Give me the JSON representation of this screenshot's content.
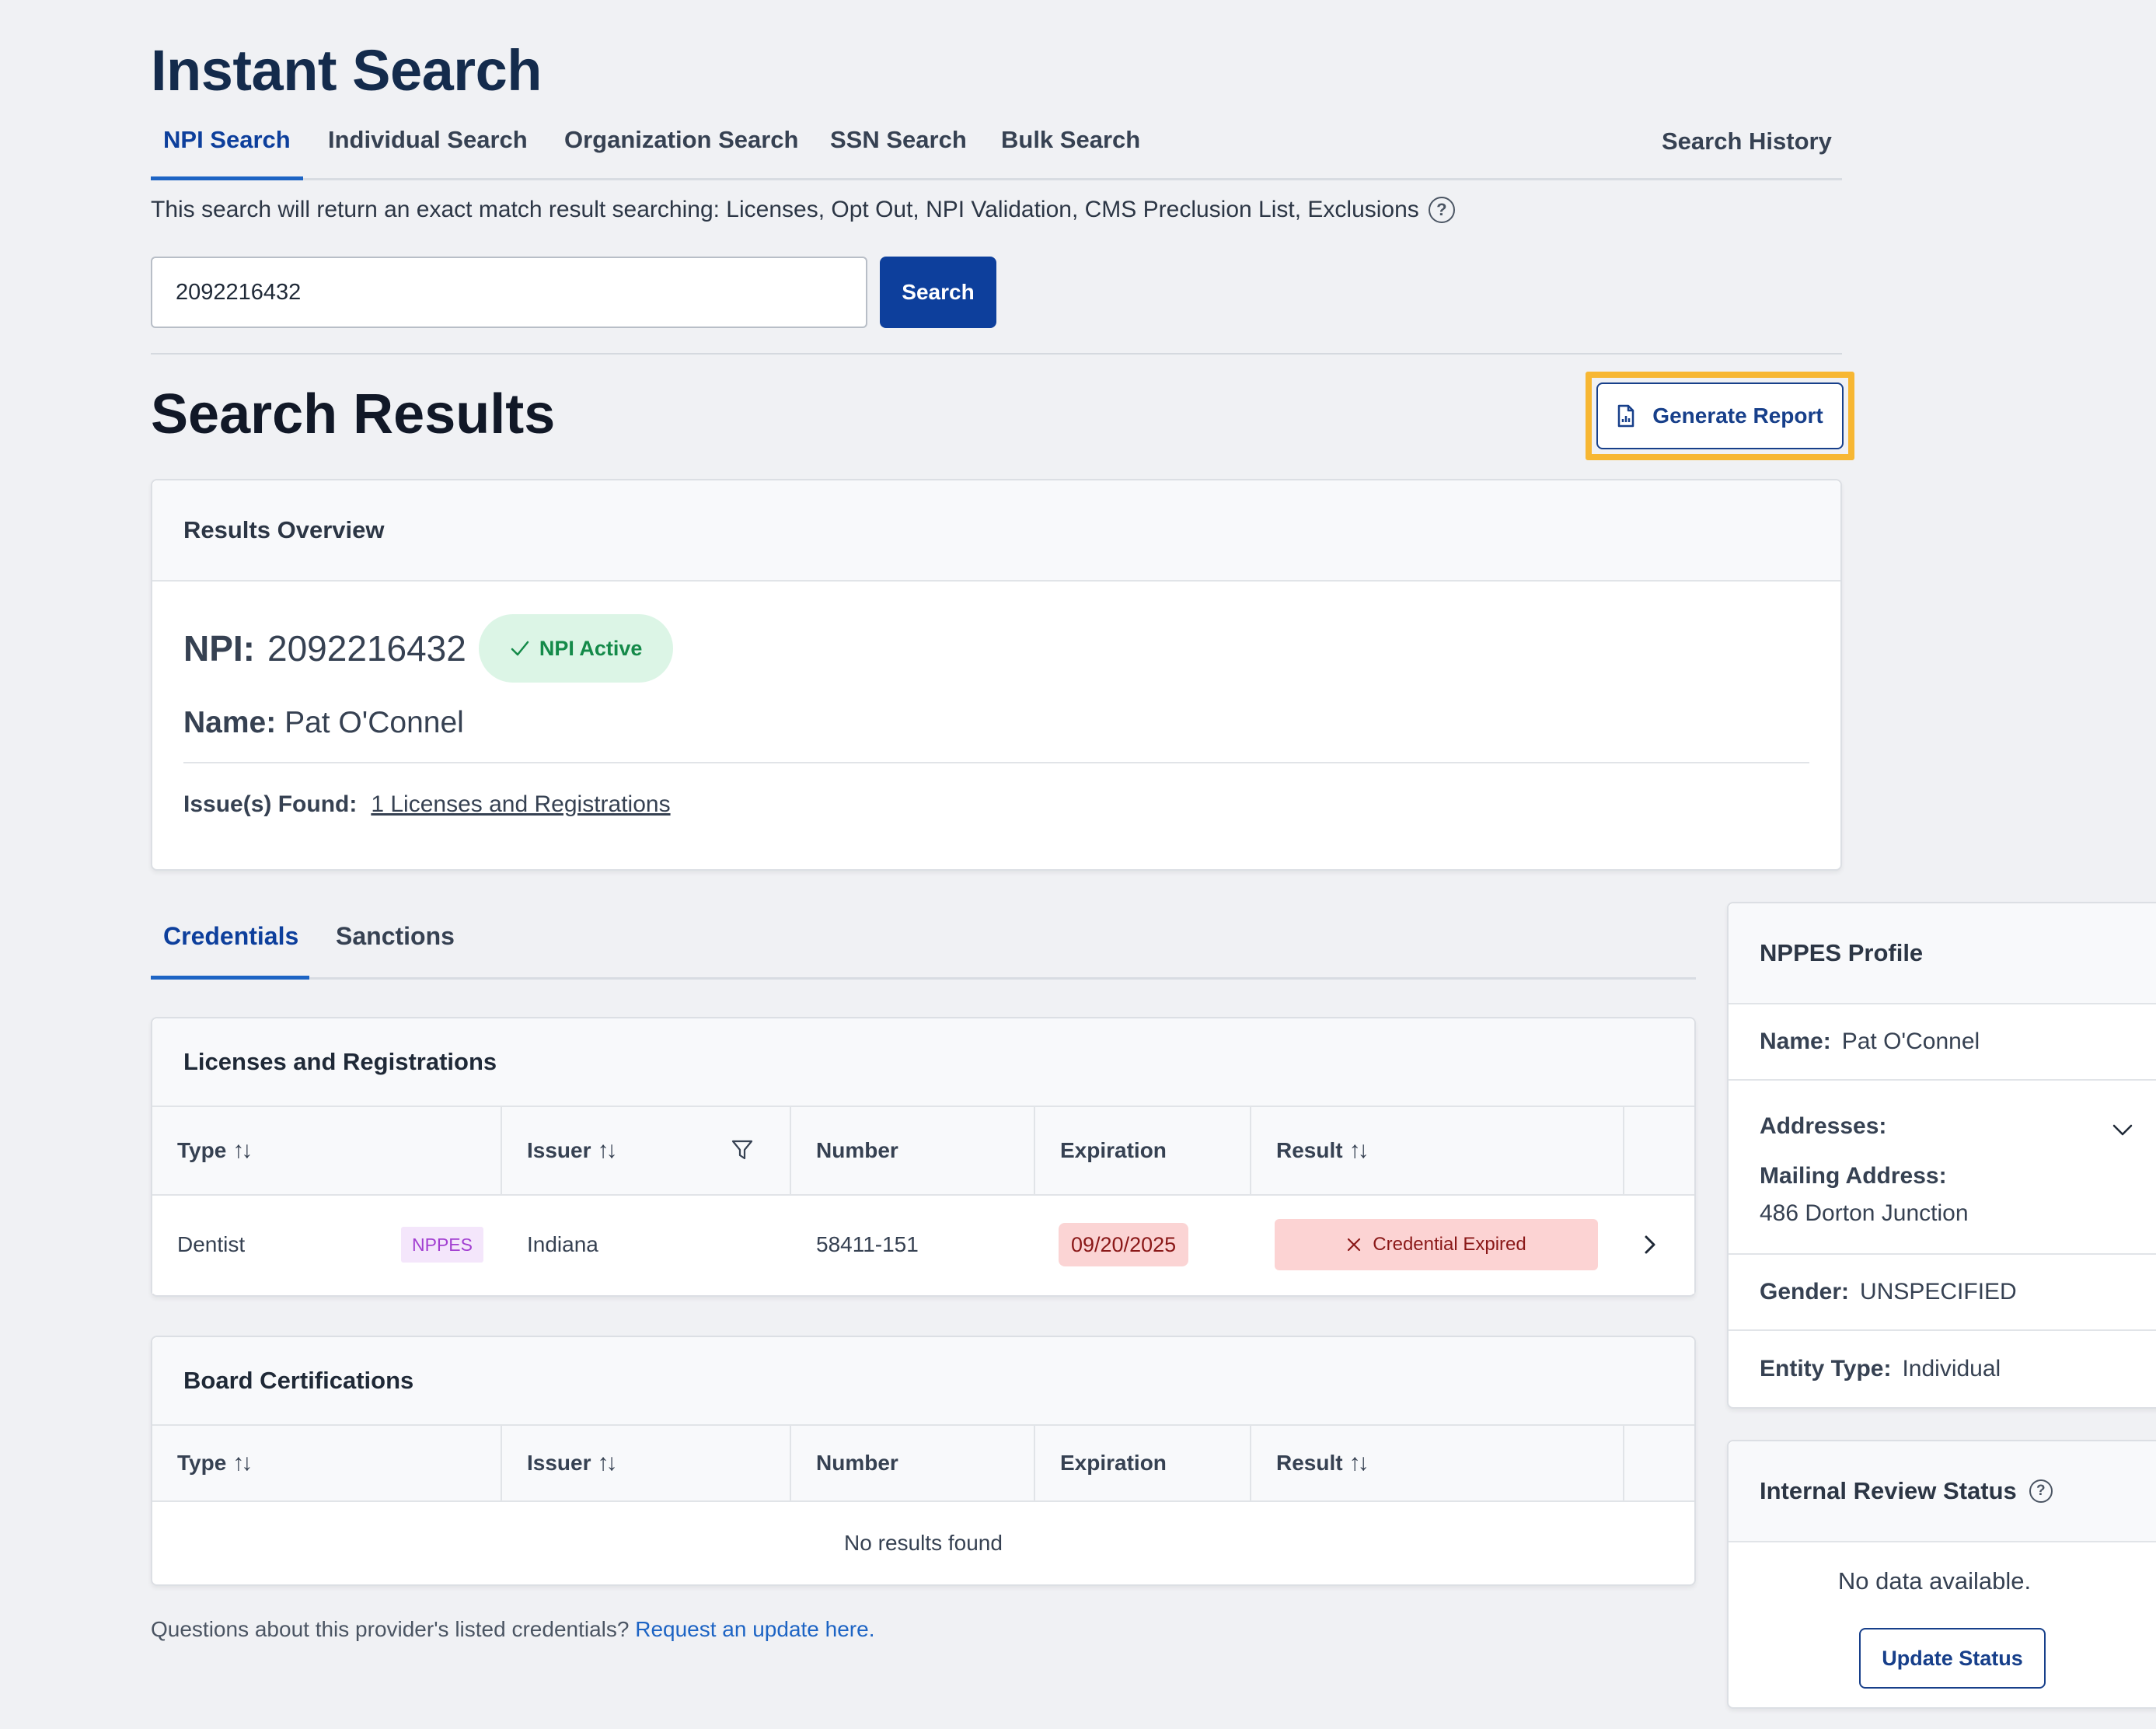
{
  "page_title": "Instant Search",
  "search_tabs": [
    {
      "label": "NPI Search",
      "active": true
    },
    {
      "label": "Individual Search",
      "active": false
    },
    {
      "label": "Organization Search",
      "active": false
    },
    {
      "label": "SSN Search",
      "active": false
    },
    {
      "label": "Bulk Search",
      "active": false
    }
  ],
  "search_history_label": "Search History",
  "search_hint": "This search will return an exact match result searching: Licenses, Opt Out, NPI Validation, CMS Preclusion List, Exclusions",
  "search": {
    "value": "2092216432",
    "button_label": "Search"
  },
  "results_title": "Search Results",
  "generate_report_label": "Generate Report",
  "overview": {
    "header": "Results Overview",
    "npi_label": "NPI:",
    "npi_value": "2092216432",
    "npi_status": "NPI Active",
    "name_label": "Name:",
    "name_value": "Pat O'Connel",
    "issues_label": "Issue(s) Found:",
    "issues_link": "1 Licenses and Registrations"
  },
  "detail_tabs": [
    {
      "label": "Credentials",
      "active": true
    },
    {
      "label": "Sanctions",
      "active": false
    }
  ],
  "licenses": {
    "title": "Licenses and Registrations",
    "columns": [
      "Type",
      "Issuer",
      "Number",
      "Expiration",
      "Result"
    ],
    "rows": [
      {
        "type": "Dentist",
        "source_tag": "NPPES",
        "issuer": "Indiana",
        "number": "58411-151",
        "expiration": "09/20/2025",
        "result": "Credential Expired"
      }
    ]
  },
  "board_certifications": {
    "title": "Board Certifications",
    "columns": [
      "Type",
      "Issuer",
      "Number",
      "Expiration",
      "Result"
    ],
    "empty_text": "No results found"
  },
  "footer": {
    "question": "Questions about this provider's listed credentials?",
    "link": "Request an update here."
  },
  "nppes_profile": {
    "header": "NPPES Profile",
    "name_label": "Name:",
    "name_value": "Pat O'Connel",
    "addresses_label": "Addresses:",
    "mailing_label": "Mailing Address:",
    "mailing_value": "486 Dorton Junction",
    "gender_label": "Gender:",
    "gender_value": "UNSPECIFIED",
    "entity_label": "Entity Type:",
    "entity_value": "Individual"
  },
  "review_status": {
    "header": "Internal Review Status",
    "empty_text": "No data available.",
    "button_label": "Update Status"
  },
  "colors": {
    "primary": "#0d3f9c",
    "active_tab": "#1d64c4",
    "highlight": "#f7b733",
    "success_bg": "#dcf5e6",
    "success_text": "#148a49",
    "error_bg": "#fbd4d4",
    "error_text": "#8a1818",
    "nppes_tag": "#a23fd1"
  }
}
